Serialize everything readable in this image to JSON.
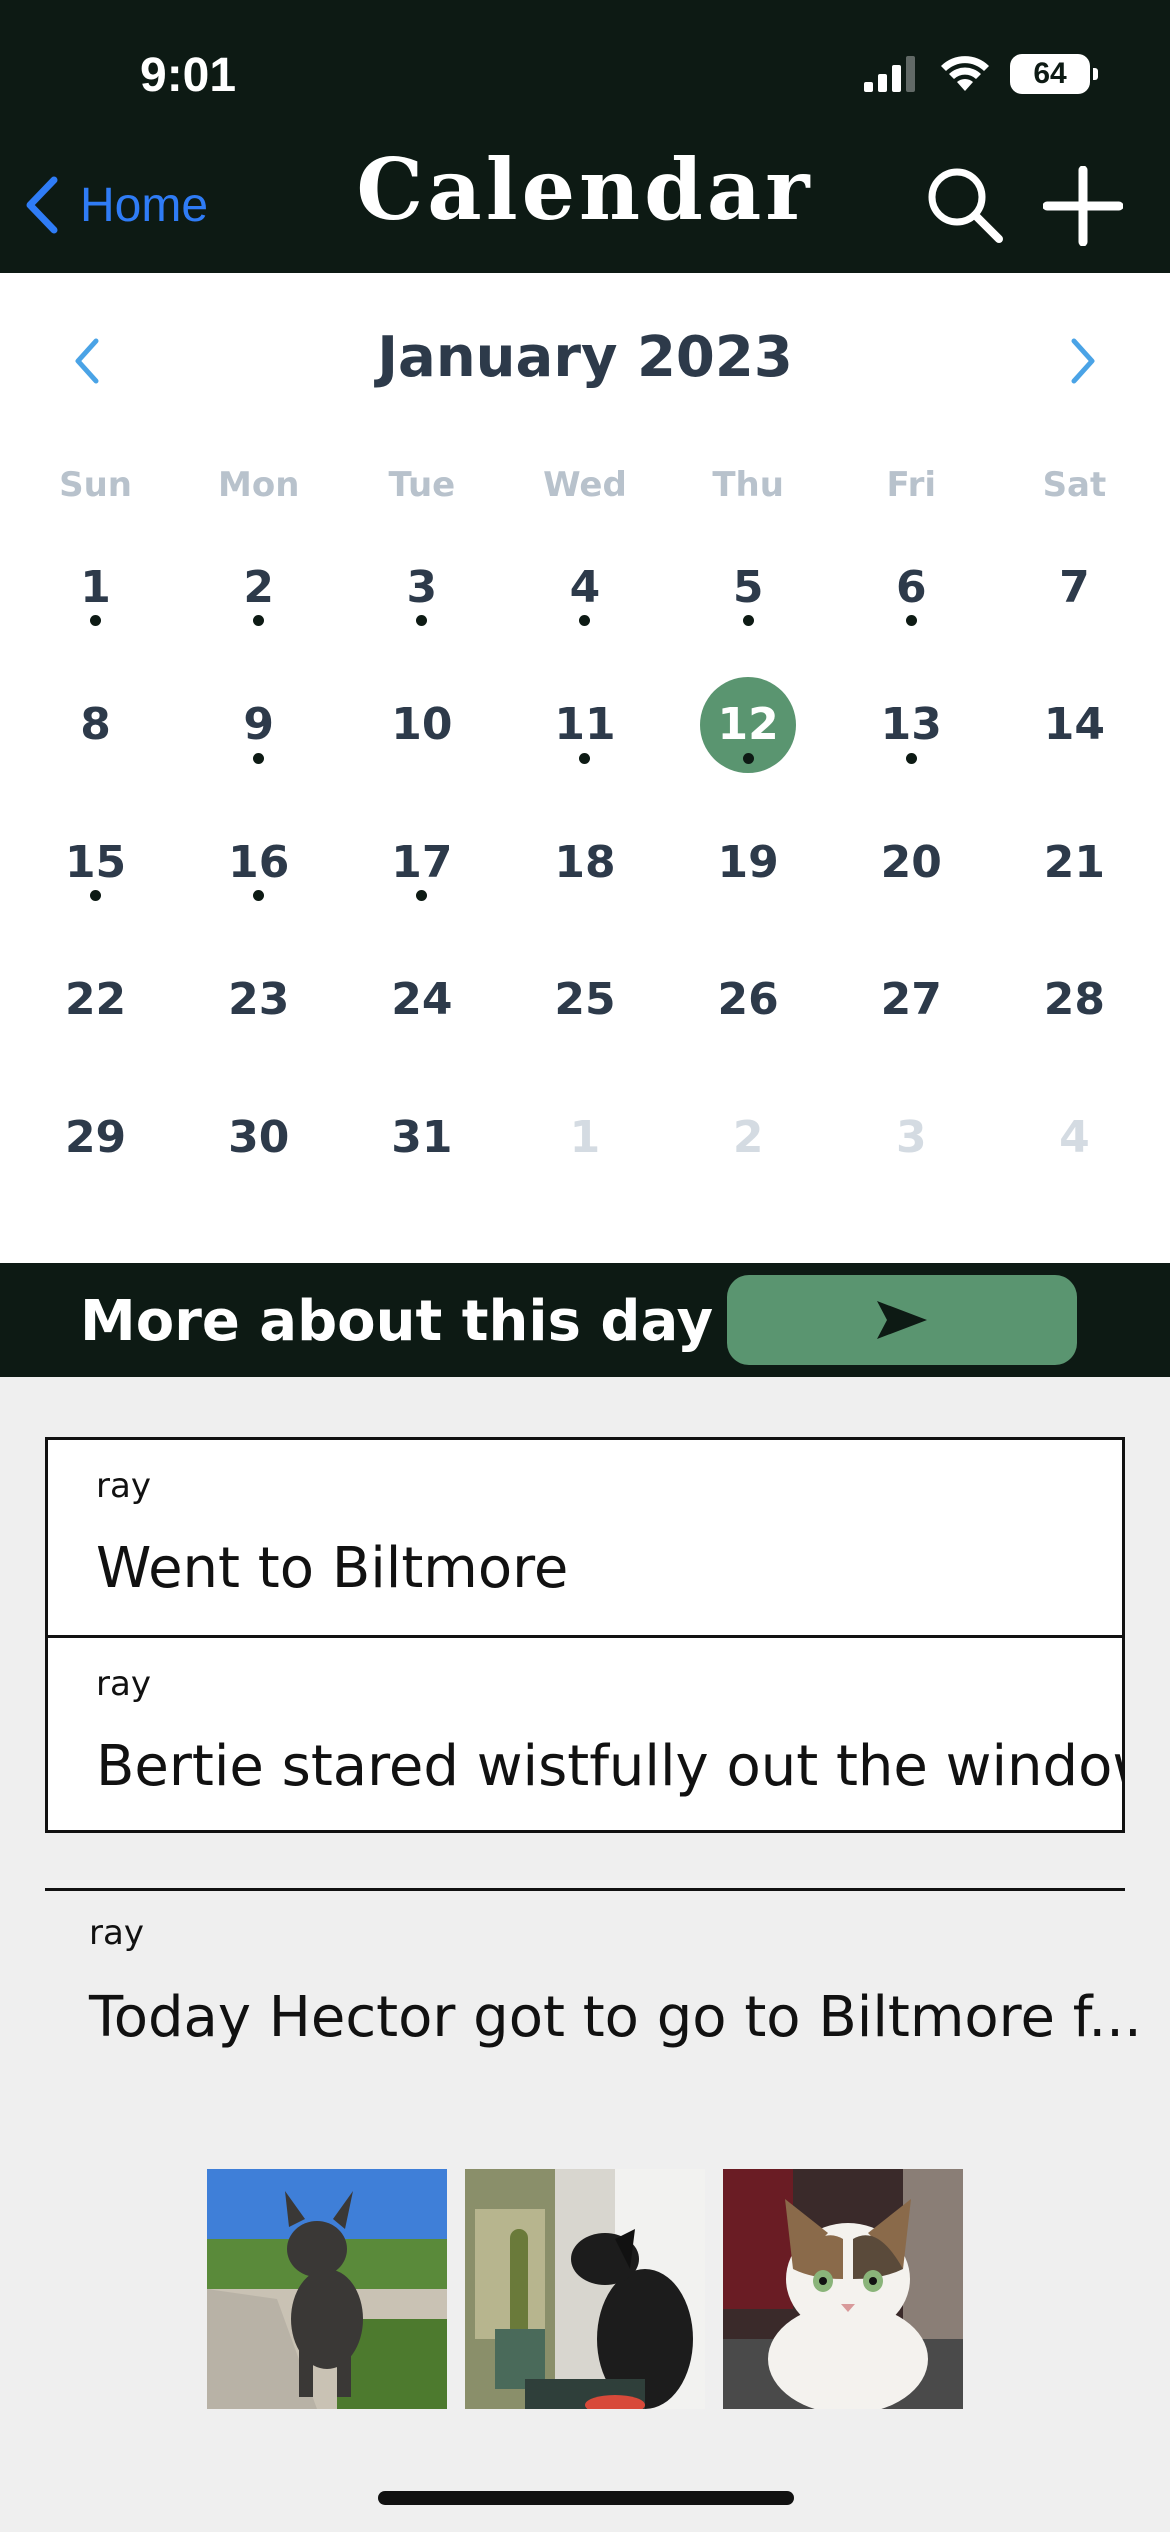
{
  "status": {
    "time": "9:01",
    "battery": "64"
  },
  "header": {
    "back_label": "Home",
    "title": "Calendar"
  },
  "calendar": {
    "month_label": "January 2023",
    "weekdays": [
      "Sun",
      "Mon",
      "Tue",
      "Wed",
      "Thu",
      "Fri",
      "Sat"
    ],
    "days": [
      {
        "num": "1",
        "dot": true
      },
      {
        "num": "2",
        "dot": true
      },
      {
        "num": "3",
        "dot": true
      },
      {
        "num": "4",
        "dot": true
      },
      {
        "num": "5",
        "dot": true
      },
      {
        "num": "6",
        "dot": true
      },
      {
        "num": "7",
        "dot": false
      },
      {
        "num": "8",
        "dot": false
      },
      {
        "num": "9",
        "dot": true
      },
      {
        "num": "10",
        "dot": false
      },
      {
        "num": "11",
        "dot": true
      },
      {
        "num": "12",
        "dot": true,
        "selected": true
      },
      {
        "num": "13",
        "dot": true
      },
      {
        "num": "14",
        "dot": false
      },
      {
        "num": "15",
        "dot": true
      },
      {
        "num": "16",
        "dot": true
      },
      {
        "num": "17",
        "dot": true
      },
      {
        "num": "18",
        "dot": false
      },
      {
        "num": "19",
        "dot": false
      },
      {
        "num": "20",
        "dot": false
      },
      {
        "num": "21",
        "dot": false
      },
      {
        "num": "22",
        "dot": false
      },
      {
        "num": "23",
        "dot": false
      },
      {
        "num": "24",
        "dot": false
      },
      {
        "num": "25",
        "dot": false
      },
      {
        "num": "26",
        "dot": false
      },
      {
        "num": "27",
        "dot": false
      },
      {
        "num": "28",
        "dot": false
      },
      {
        "num": "29",
        "dot": false
      },
      {
        "num": "30",
        "dot": false
      },
      {
        "num": "31",
        "dot": false
      },
      {
        "num": "1",
        "dot": false,
        "out": true
      },
      {
        "num": "2",
        "dot": false,
        "out": true
      },
      {
        "num": "3",
        "dot": false,
        "out": true
      },
      {
        "num": "4",
        "dot": false,
        "out": true
      }
    ],
    "selected_color": "#5a9570"
  },
  "more": {
    "label": "More about this day"
  },
  "posts": [
    {
      "author": "ray",
      "text": "Went to Biltmore"
    },
    {
      "author": "ray",
      "text": "Bertie stared wistfully out the window"
    },
    {
      "author": "ray",
      "text": "Today Hector got to go to Biltmore f..."
    }
  ],
  "photos": [
    "french-bulldog-photo",
    "black-dog-photo",
    "cat-photo"
  ],
  "colors": {
    "header_bg": "#0d1a14",
    "accent_green": "#5a9570",
    "link_blue": "#2f7cf6",
    "nav_arrow": "#4aa3e6"
  }
}
